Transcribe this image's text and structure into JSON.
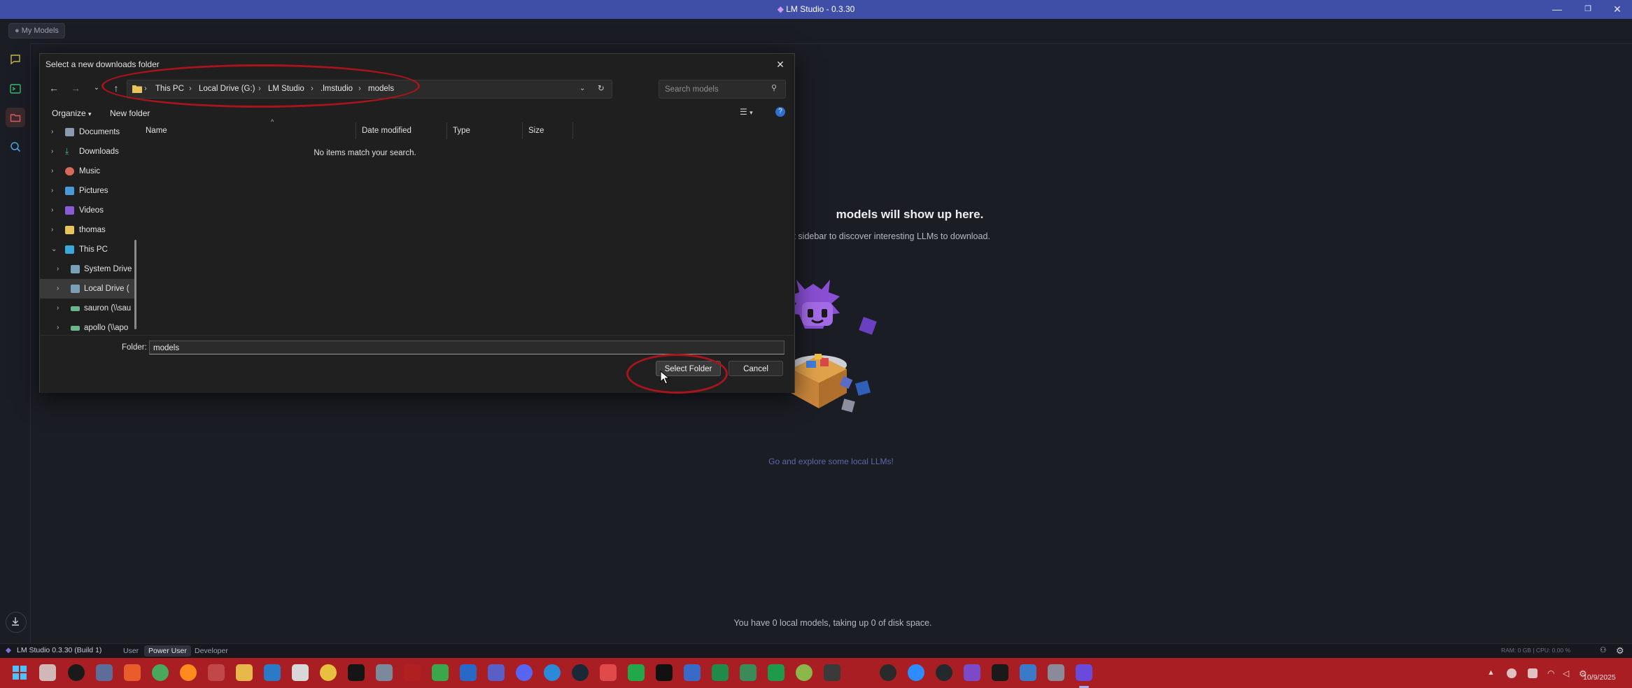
{
  "window": {
    "title": "LM Studio - 0.3.30"
  },
  "header": {
    "breadcrumb": "My Models"
  },
  "main": {
    "empty_title": "models will show up here.",
    "empty_subtitle": "ft sidebar to discover interesting LLMs to download.",
    "explore_link": "Go and explore some local LLMs!",
    "footer_text": "You have 0 local models, taking up 0 of disk space."
  },
  "statusbar": {
    "app_version": "LM Studio 0.3.30 (Build 1)",
    "modes": [
      "User",
      "Power User",
      "Developer"
    ],
    "active_mode": "Power User",
    "resources": "RAM: 0 GB  |  CPU: 0.00 %"
  },
  "dialog": {
    "title": "Select a new downloads folder",
    "address_crumbs": [
      "This PC",
      "Local Drive (G:)",
      "LM Studio",
      ".lmstudio",
      "models"
    ],
    "search_placeholder": "Search models",
    "organize_label": "Organize",
    "new_folder_label": "New folder",
    "nav_items": [
      {
        "label": "Documents",
        "icon": "documents-icon"
      },
      {
        "label": "Downloads",
        "icon": "downloads-icon"
      },
      {
        "label": "Music",
        "icon": "music-icon"
      },
      {
        "label": "Pictures",
        "icon": "pictures-icon"
      },
      {
        "label": "Videos",
        "icon": "videos-icon"
      },
      {
        "label": "thomas",
        "icon": "folder-icon"
      },
      {
        "label": "This PC",
        "icon": "computer-icon"
      },
      {
        "label": "System Drive",
        "icon": "drive-icon"
      },
      {
        "label": "Local Drive (",
        "icon": "drive-icon"
      },
      {
        "label": "sauron (\\\\sau",
        "icon": "network-drive-icon"
      },
      {
        "label": "apollo (\\\\apo",
        "icon": "network-drive-icon"
      }
    ],
    "columns": [
      "Name",
      "Date modified",
      "Type",
      "Size"
    ],
    "empty_message": "No items match your search.",
    "folder_label": "Folder:",
    "folder_value": "models",
    "select_button": "Select Folder",
    "cancel_button": "Cancel"
  },
  "taskbar": {
    "date": "10/9/2025",
    "accent": "#a81e22"
  },
  "colors": {
    "titlebar": "#3f4fa8",
    "annotation": "#a8141c",
    "background": "#1b1d24"
  }
}
